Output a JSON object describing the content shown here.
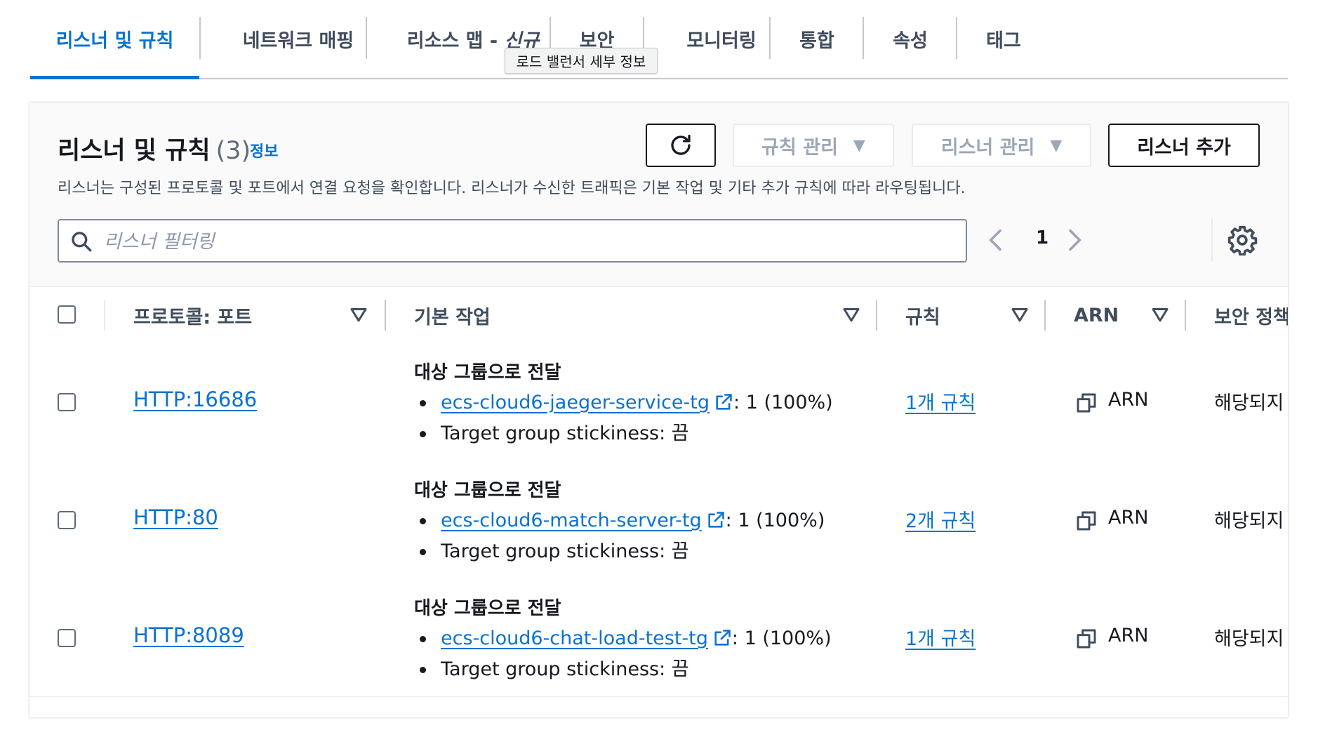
{
  "tabs": [
    {
      "label": "리스너 및 규칙",
      "active": true
    },
    {
      "label": "네트워크 매핑"
    },
    {
      "label": "리소스 맵 - ",
      "badge": "신규"
    },
    {
      "label": "보안"
    },
    {
      "label": "모니터링"
    },
    {
      "label": "통합"
    },
    {
      "label": "속성"
    },
    {
      "label": "태그"
    }
  ],
  "tooltip": "로드 밸런서 세부 정보",
  "panel": {
    "title": "리스너 및 규칙",
    "count": "(3)",
    "info": "정보",
    "description": "리스너는 구성된 프로토콜 및 포트에서 연결 요청을 확인합니다. 리스너가 수신한 트래픽은 기본 작업 및 기타 추가 규칙에 따라 라우팅됩니다.",
    "buttons": {
      "manage_rules": "규칙 관리",
      "manage_listeners": "리스너 관리",
      "add_listener": "리스너 추가"
    },
    "search_placeholder": "리스너 필터링",
    "page": "1"
  },
  "table": {
    "columns": [
      "프로토콜: 포트",
      "기본 작업",
      "규칙",
      "ARN",
      "보안 정책"
    ],
    "rows": [
      {
        "listener": "HTTP:16686",
        "action_title": "대상 그룹으로 전달",
        "target_group": "ecs-cloud6-jaeger-service-tg",
        "weight": ": 1 (100%)",
        "stickiness": "Target group stickiness: 끔",
        "rules": "1개 규칙",
        "arn": "ARN",
        "security_policy": "해당되지"
      },
      {
        "listener": "HTTP:80",
        "action_title": "대상 그룹으로 전달",
        "target_group": "ecs-cloud6-match-server-tg",
        "weight": ": 1 (100%)",
        "stickiness": "Target group stickiness: 끔",
        "rules": "2개 규칙",
        "arn": "ARN",
        "security_policy": "해당되지"
      },
      {
        "listener": "HTTP:8089",
        "action_title": "대상 그룹으로 전달",
        "target_group": "ecs-cloud6-chat-load-test-tg",
        "weight": ": 1 (100%)",
        "stickiness": "Target group stickiness: 끔",
        "rules": "1개 규칙",
        "arn": "ARN",
        "security_policy": "해당되지"
      }
    ]
  },
  "colors": {
    "link": "#0972d3",
    "text": "#16191f",
    "muted": "#414d5c",
    "disabled": "#9ba7b6"
  }
}
